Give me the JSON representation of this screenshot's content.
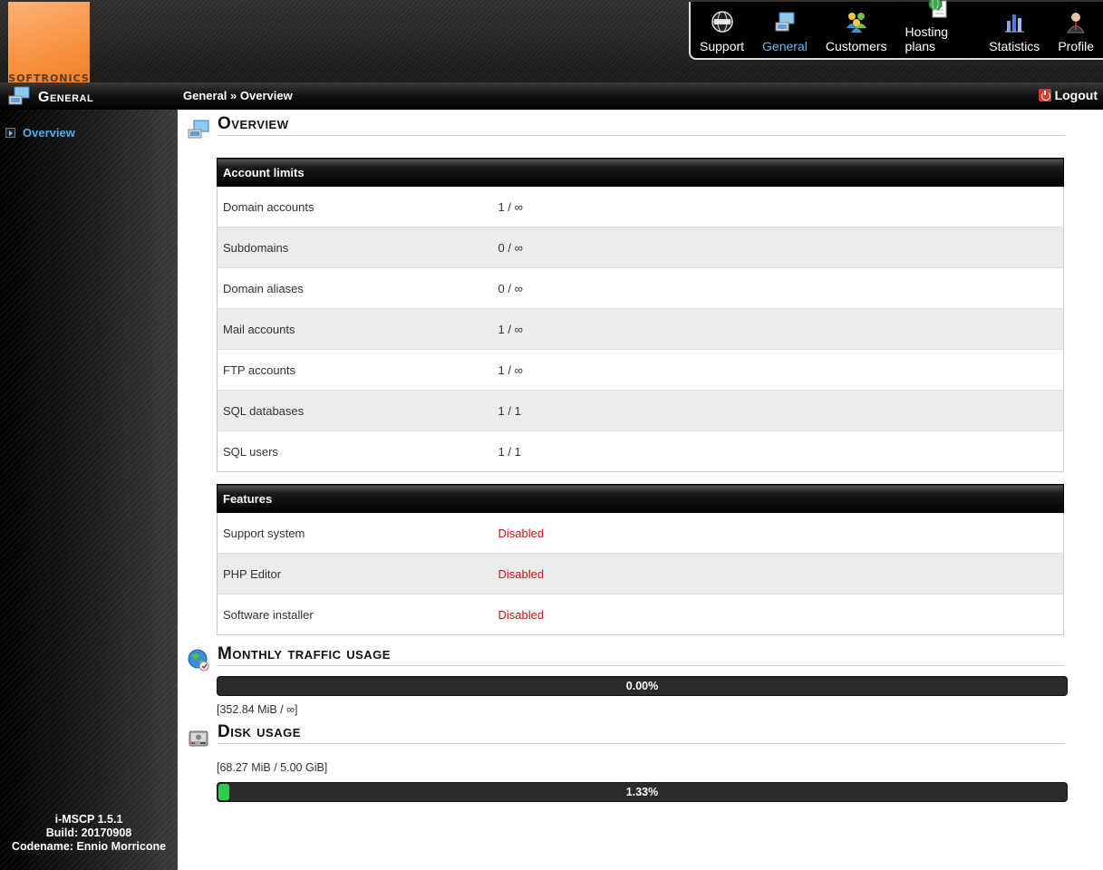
{
  "logo": {
    "text": "SOFTRONICS"
  },
  "topnav": [
    {
      "label": "Support",
      "icon": "support-globe-icon",
      "active": false
    },
    {
      "label": "General",
      "icon": "general-monitor-icon",
      "active": true
    },
    {
      "label": "Customers",
      "icon": "customers-people-icon",
      "active": false
    },
    {
      "label": "Hosting plans",
      "icon": "hosting-plans-icon",
      "active": false
    },
    {
      "label": "Statistics",
      "icon": "statistics-icon",
      "active": false
    },
    {
      "label": "Profile",
      "icon": "profile-user-icon",
      "active": false
    }
  ],
  "titlebar": {
    "section": "General",
    "breadcrumb": "General » Overview",
    "logout": "Logout"
  },
  "sidebar": {
    "items": [
      {
        "label": "Overview"
      }
    ],
    "version_lines": [
      "i-MSCP 1.5.1",
      "Build: 20170908",
      "Codename: Ennio Morricone"
    ]
  },
  "overview": {
    "title": "Overview",
    "account_limits": {
      "header": "Account limits",
      "rows": [
        {
          "label": "Domain accounts",
          "value": "1 / ∞"
        },
        {
          "label": "Subdomains",
          "value": "0 / ∞"
        },
        {
          "label": "Domain aliases",
          "value": "0 / ∞"
        },
        {
          "label": "Mail accounts",
          "value": "1 / ∞"
        },
        {
          "label": "FTP accounts",
          "value": "1 / ∞"
        },
        {
          "label": "SQL databases",
          "value": "1 / 1"
        },
        {
          "label": "SQL users",
          "value": "1 / 1"
        }
      ]
    },
    "features": {
      "header": "Features",
      "rows": [
        {
          "label": "Support system",
          "value": "Disabled"
        },
        {
          "label": "PHP Editor",
          "value": "Disabled"
        },
        {
          "label": "Software installer",
          "value": "Disabled"
        }
      ]
    }
  },
  "traffic": {
    "title": "Monthly traffic usage",
    "percent_label": "0.00%",
    "percent": 0,
    "usage": "[352.84 MiB / ∞]"
  },
  "disk": {
    "title": "Disk usage",
    "usage": "[68.27 MiB / 5.00 GiB]",
    "percent_label": "1.33%",
    "percent": 1.33
  },
  "colors": {
    "accent": "#4ab0ec",
    "disabled": "#c81414",
    "progress": "#2ecc4e"
  }
}
